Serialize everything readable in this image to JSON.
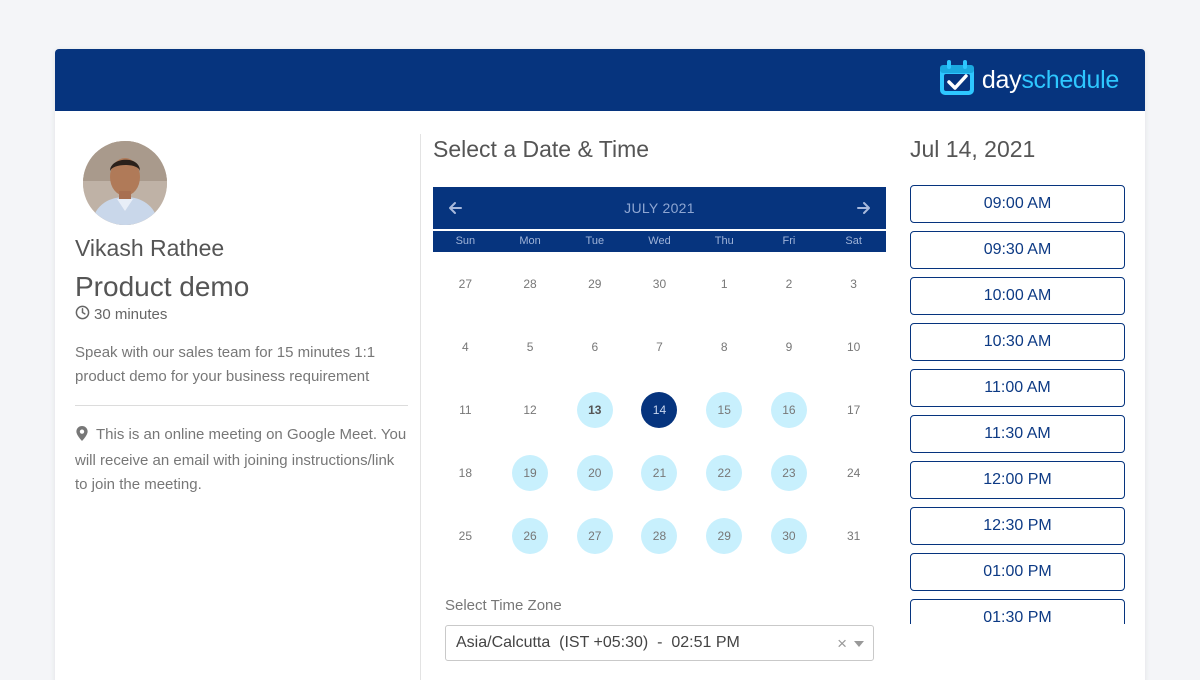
{
  "brand": {
    "name_part1": "day",
    "name_part2": "schedule",
    "accent": "#2ec7ff",
    "bar_color": "#06347e"
  },
  "host": {
    "name": "Vikash Rathee",
    "avatar": "avatar-photo"
  },
  "event": {
    "title": "Product demo",
    "duration": "30 minutes",
    "description": "Speak with our sales team for 15 minutes 1:1 product demo for your business requirement",
    "location": "This is an online meeting on Google Meet. You will receive an email with joining instructions/link to join the meeting."
  },
  "calendar": {
    "section_title": "Select a Date & Time",
    "month_label": "JULY 2021",
    "weekdays": [
      "Sun",
      "Mon",
      "Tue",
      "Wed",
      "Thu",
      "Fri",
      "Sat"
    ],
    "weeks": [
      [
        {
          "d": "27"
        },
        {
          "d": "28"
        },
        {
          "d": "29"
        },
        {
          "d": "30"
        },
        {
          "d": "1"
        },
        {
          "d": "2"
        },
        {
          "d": "3"
        }
      ],
      [
        {
          "d": "4"
        },
        {
          "d": "5"
        },
        {
          "d": "6"
        },
        {
          "d": "7"
        },
        {
          "d": "8"
        },
        {
          "d": "9"
        },
        {
          "d": "10"
        }
      ],
      [
        {
          "d": "11"
        },
        {
          "d": "12"
        },
        {
          "d": "13",
          "available": true,
          "today": true
        },
        {
          "d": "14",
          "selected": true
        },
        {
          "d": "15",
          "available": true
        },
        {
          "d": "16",
          "available": true
        },
        {
          "d": "17"
        }
      ],
      [
        {
          "d": "18"
        },
        {
          "d": "19",
          "available": true
        },
        {
          "d": "20",
          "available": true
        },
        {
          "d": "21",
          "available": true
        },
        {
          "d": "22",
          "available": true
        },
        {
          "d": "23",
          "available": true
        },
        {
          "d": "24"
        }
      ],
      [
        {
          "d": "25"
        },
        {
          "d": "26",
          "available": true
        },
        {
          "d": "27",
          "available": true
        },
        {
          "d": "28",
          "available": true
        },
        {
          "d": "29",
          "available": true
        },
        {
          "d": "30",
          "available": true
        },
        {
          "d": "31"
        }
      ]
    ]
  },
  "timezone": {
    "label": "Select Time Zone",
    "value": "Asia/Calcutta  (IST +05:30)  -  02:51 PM",
    "clear": "×"
  },
  "slots": {
    "date_title": "Jul 14, 2021",
    "times": [
      "09:00 AM",
      "09:30 AM",
      "10:00 AM",
      "10:30 AM",
      "11:00 AM",
      "11:30 AM",
      "12:00 PM",
      "12:30 PM",
      "01:00 PM",
      "01:30 PM"
    ]
  }
}
